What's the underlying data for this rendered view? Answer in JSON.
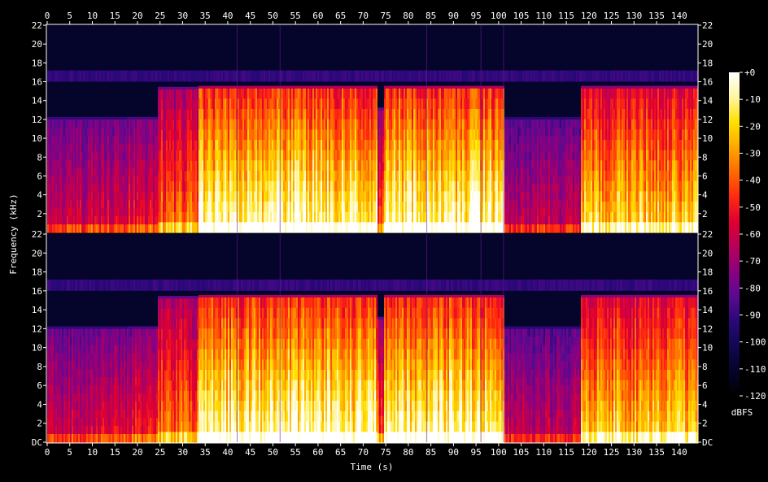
{
  "chart_data": {
    "type": "heatmap",
    "title": "",
    "xlabel": "Time (s)",
    "ylabel": "Frequency (kHz)",
    "x_ticks": [
      0,
      5,
      10,
      15,
      20,
      25,
      30,
      35,
      40,
      45,
      50,
      55,
      60,
      65,
      70,
      75,
      80,
      85,
      90,
      95,
      100,
      105,
      110,
      115,
      120,
      125,
      130,
      135,
      140
    ],
    "xlim": [
      0,
      144
    ],
    "channels": [
      {
        "y_ticks": [
          "22",
          "20",
          "18",
          "16",
          "14",
          "12",
          "10",
          "8",
          "6",
          "4",
          "2"
        ],
        "ylim_khz": [
          0,
          22
        ]
      },
      {
        "y_ticks": [
          "22",
          "20",
          "18",
          "16",
          "14",
          "12",
          "10",
          "8",
          "6",
          "4",
          "2",
          "DC"
        ],
        "ylim_khz": [
          0,
          22
        ]
      }
    ],
    "colorbar": {
      "label": "dBFS",
      "ticks": [
        "+0",
        "-10",
        "-20",
        "-30",
        "-40",
        "-50",
        "-60",
        "-70",
        "-80",
        "-90",
        "-100",
        "-110",
        "-120"
      ],
      "range_db": [
        -120,
        0
      ],
      "colors": [
        "#ffffff",
        "#fff6a0",
        "#ffe000",
        "#ffa800",
        "#ff6a00",
        "#ff2a10",
        "#e00030",
        "#b80058",
        "#8a0080",
        "#5a0a90",
        "#2a0878",
        "#100850",
        "#05042a",
        "#000000"
      ]
    },
    "segments": [
      {
        "start_s": 0,
        "end_s": 17.5,
        "cutoff_khz": 12,
        "level": 0.45
      },
      {
        "start_s": 17.5,
        "end_s": 24.5,
        "cutoff_khz": 12,
        "level": 0.5
      },
      {
        "start_s": 24.5,
        "end_s": 33.5,
        "cutoff_khz": 15.2,
        "level": 0.6
      },
      {
        "start_s": 33.5,
        "end_s": 73,
        "cutoff_khz": 15.3,
        "level": 0.82
      },
      {
        "start_s": 73,
        "end_s": 74.5,
        "cutoff_khz": 13,
        "level": 0.55
      },
      {
        "start_s": 74.5,
        "end_s": 101,
        "cutoff_khz": 15.3,
        "level": 0.82
      },
      {
        "start_s": 101,
        "end_s": 118,
        "cutoff_khz": 12,
        "level": 0.42
      },
      {
        "start_s": 118,
        "end_s": 143,
        "cutoff_khz": 15.3,
        "level": 0.72
      }
    ]
  }
}
